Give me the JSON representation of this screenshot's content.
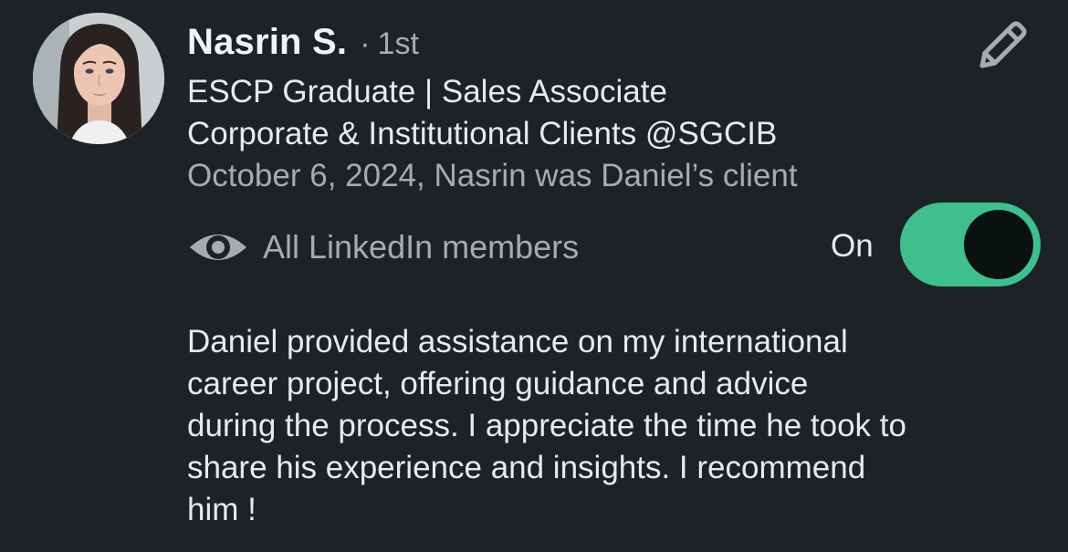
{
  "recommendation": {
    "author_name": "Nasrin S.",
    "separator": "·",
    "connection_degree": "1st",
    "headline_line1": "ESCP Graduate | Sales Associate",
    "headline_line2": "Corporate & Institutional Clients @SGCIB",
    "relationship": "October 6, 2024, Nasrin was Daniel’s client",
    "visibility_label": "All LinkedIn members",
    "toggle_label": "On",
    "toggle_on": true,
    "text": "Daniel provided assistance on my international\ncareer project, offering guidance and advice\nduring the process. I appreciate the time he took to\nshare his experience and insights. I recommend\nhim !"
  },
  "icons": {
    "edit": "pencil-icon",
    "visibility": "eye-icon"
  },
  "colors": {
    "background": "#1d2226",
    "toggle_on": "#3fbf8d",
    "muted_text": "#a8abad"
  }
}
